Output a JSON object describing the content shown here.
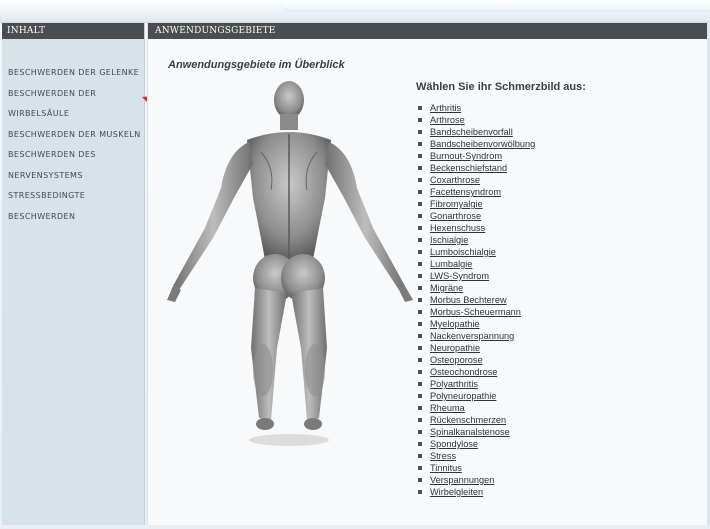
{
  "sidebar": {
    "header": "INHALT",
    "items": [
      "BESCHWERDEN DER GELENKE",
      "BESCHWERDEN DER",
      "WIRBELSÄULE",
      "BESCHWERDEN DER MUSKELN",
      "BESCHWERDEN DES",
      "NERVENSYSTEMS",
      "STRESSBEDINGTE",
      "BESCHWERDEN"
    ]
  },
  "main": {
    "header": "ANWENDUNGSGEBIETE",
    "subtitle": "Anwendungsgebiete im Überblick",
    "prompt": "Wählen Sie ihr Schmerzbild aus:",
    "conditions": [
      "Arthritis",
      "Arthrose",
      "Bandscheibenvorfall",
      "Bandscheibenvorwölbung",
      "Burnout-Syndrom",
      "Beckenschiefstand",
      "Coxarthrose",
      "Facettensyndrom",
      "Fibromyalgie",
      "Gonarthrose",
      "Hexenschuss",
      "Ischialgie",
      "Lumboischialgie",
      "Lumbalgie",
      "LWS-Syndrom",
      "Migräne",
      "Morbus Bechterew",
      "Morbus-Scheuermann",
      "Myelopathie",
      "Nackenverspannung",
      "Neuropathie",
      "Osteoporose",
      "Osteochondrose",
      "Polyarthritis",
      "Polyneuropathie",
      "Rheuma",
      "Rückenschmerzen",
      "Spinalkanalstenose",
      "Spondylose",
      "Stress",
      "Tinnitus",
      "Verspannungen",
      "Wirbelgleiten"
    ]
  },
  "colors": {
    "header_bg": "#4b4d4f",
    "sidebar_bg": "#d8e2e9",
    "arrow": "#c0392b"
  },
  "icons": {
    "bullet": "square-bullet-icon",
    "pointer": "dashed-arrow-icon",
    "figure": "human-anatomy-back-image"
  }
}
